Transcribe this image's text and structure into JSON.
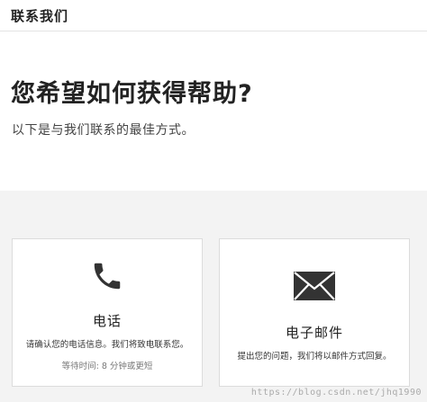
{
  "header": {
    "title": "联系我们"
  },
  "hero": {
    "title": "您希望如何获得帮助?",
    "subtitle": "以下是与我们联系的最佳方式。"
  },
  "cards": {
    "phone": {
      "icon": "phone-icon",
      "label": "电话",
      "description": "请确认您的电话信息。我们将致电联系您。",
      "wait": "等待时间: 8 分钟或更短"
    },
    "email": {
      "icon": "envelope-icon",
      "label": "电子邮件",
      "description": "提出您的问题，我们将以邮件方式回复。"
    }
  },
  "watermark": "https://blog.csdn.net/jhq1990",
  "colors": {
    "background": "#ffffff",
    "lower_background": "#f3f3f3",
    "icon": "#333333",
    "divider": "#e4e4e4"
  }
}
